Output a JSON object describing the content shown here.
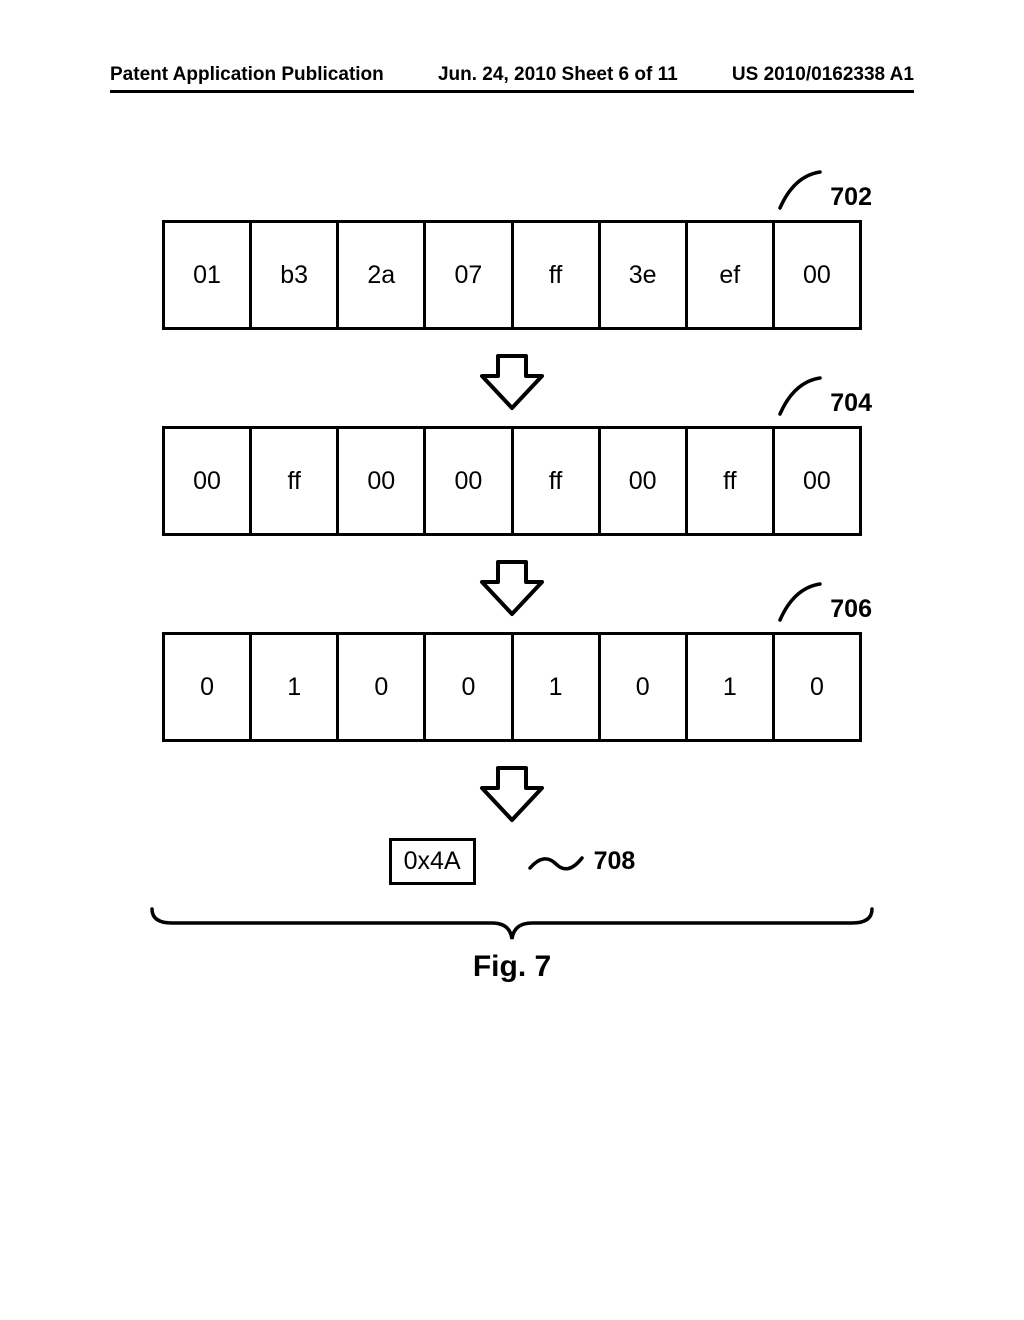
{
  "header": {
    "left": "Patent Application Publication",
    "center": "Jun. 24, 2010  Sheet 6 of 11",
    "right": "US 2010/0162338 A1"
  },
  "rows": [
    {
      "ref": "702",
      "cells": [
        "01",
        "b3",
        "2a",
        "07",
        "ff",
        "3e",
        "ef",
        "00"
      ]
    },
    {
      "ref": "704",
      "cells": [
        "00",
        "ff",
        "00",
        "00",
        "ff",
        "00",
        "ff",
        "00"
      ]
    },
    {
      "ref": "706",
      "cells": [
        "0",
        "1",
        "0",
        "0",
        "1",
        "0",
        "1",
        "0"
      ]
    }
  ],
  "result": {
    "value": "0x4A",
    "ref": "708"
  },
  "figure_label": "Fig. 7"
}
